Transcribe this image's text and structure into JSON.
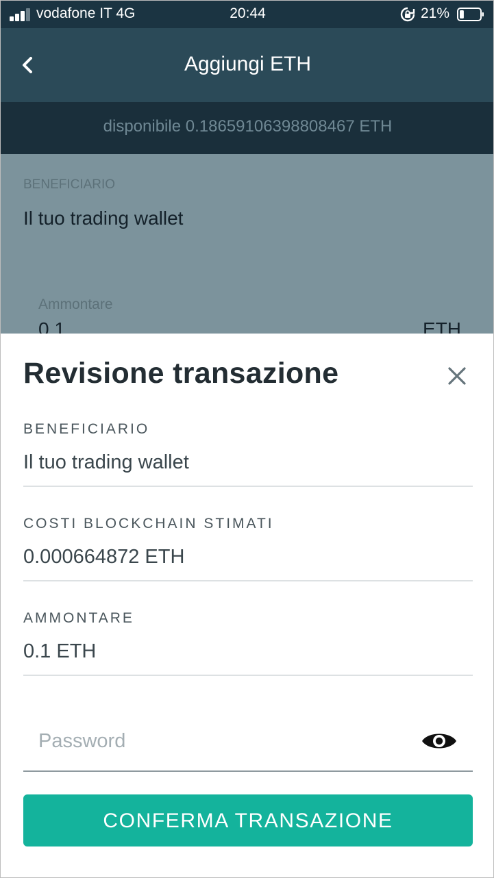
{
  "status_bar": {
    "carrier": "vodafone IT  4G",
    "time": "20:44",
    "battery_percent": "21%",
    "battery_level": 0.21,
    "signal_bars_active": 3
  },
  "header": {
    "title": "Aggiungi ETH",
    "back_icon": "chevron-left-icon",
    "available": "disponibile 0.18659106398808467 ETH"
  },
  "background_form": {
    "recipient_label": "BENEFICIARIO",
    "recipient_value": "Il tuo trading wallet",
    "amount_label": "Ammontare",
    "amount_value": "0.1",
    "amount_unit": "ETH"
  },
  "sheet": {
    "title": "Revisione transazione",
    "close_icon": "close-icon",
    "rows": [
      {
        "label": "BENEFICIARIO",
        "value": "Il tuo trading wallet"
      },
      {
        "label": "COSTI BLOCKCHAIN STIMATI",
        "value": "0.000664872 ETH"
      },
      {
        "label": "AMMONTARE",
        "value": "0.1 ETH"
      }
    ],
    "password": {
      "placeholder": "Password",
      "value": "",
      "toggle_icon": "eye-icon"
    },
    "confirm_label": "CONFERMA TRANSAZIONE"
  },
  "colors": {
    "status_bar": "#1b3442",
    "header": "#2b4a58",
    "available_bar": "#1a2f3b",
    "overlay": "#7c939c",
    "accent": "#14b39c",
    "text_dark": "#232d33"
  }
}
